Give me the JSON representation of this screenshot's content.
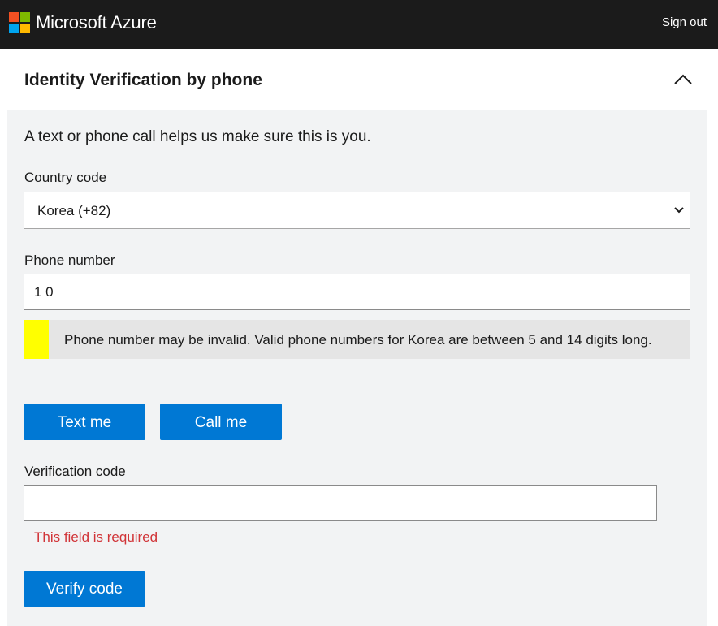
{
  "header": {
    "brand": "Microsoft Azure",
    "sign_out": "Sign out",
    "logo_colors": [
      "#f25022",
      "#7fba00",
      "#00a4ef",
      "#ffb900"
    ]
  },
  "section": {
    "title": "Identity Verification by phone",
    "collapse_icon": "chevron-up-icon"
  },
  "form": {
    "intro": "A text or phone call helps us make sure this is you.",
    "country_code": {
      "label": "Country code",
      "value": "Korea (+82)",
      "icon": "chevron-down-icon"
    },
    "phone_number": {
      "label": "Phone number",
      "value": "1 0"
    },
    "warning": {
      "message": "Phone number may be invalid. Valid phone numbers for Korea are between 5 and 14 digits long.",
      "color": "#ffff00"
    },
    "buttons": {
      "text_me": "Text me",
      "call_me": "Call me"
    },
    "verification_code": {
      "label": "Verification code",
      "value": "",
      "error": "This field is required"
    },
    "verify_button": "Verify code"
  },
  "colors": {
    "accent": "#0078d4",
    "error": "#d13438",
    "topbar": "#1b1b1b",
    "panel": "#f2f3f4"
  }
}
